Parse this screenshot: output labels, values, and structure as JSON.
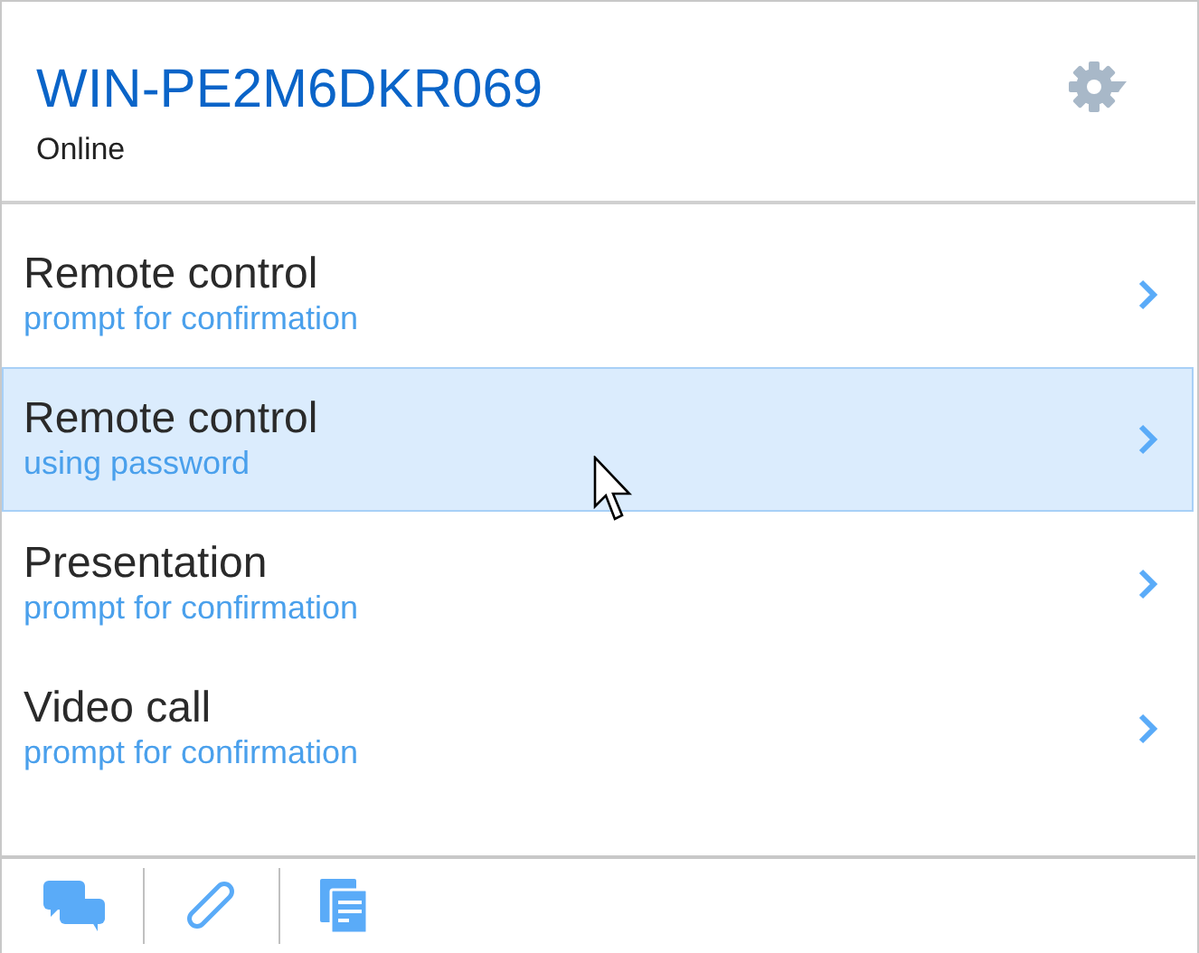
{
  "header": {
    "title": "WIN-PE2M6DKR069",
    "status": "Online"
  },
  "actions": [
    {
      "label": "Remote control",
      "detail": "prompt for confirmation",
      "selected": false
    },
    {
      "label": "Remote control",
      "detail": "using password",
      "selected": true
    },
    {
      "label": "Presentation",
      "detail": "prompt for confirmation",
      "selected": false
    },
    {
      "label": "Video call",
      "detail": "prompt for confirmation",
      "selected": false
    }
  ],
  "toolbar": [
    {
      "kind": "chat"
    },
    {
      "kind": "attach"
    },
    {
      "kind": "files"
    }
  ]
}
